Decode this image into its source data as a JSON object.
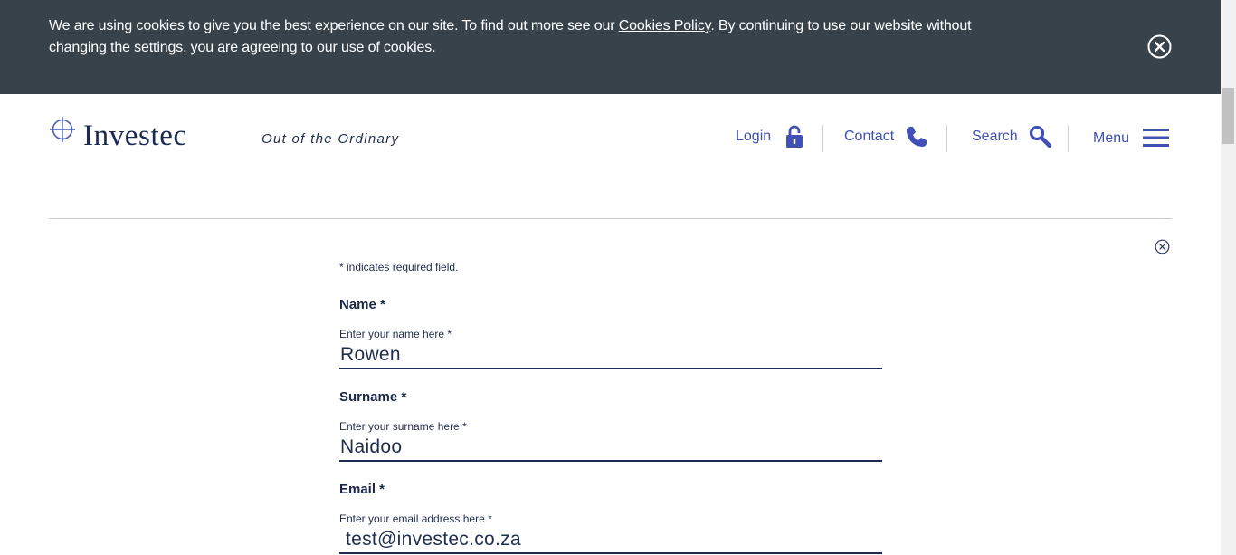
{
  "cookie_banner": {
    "text_before": "We are using cookies to give you the best experience on our site. To find out more see our ",
    "link": "Cookies Policy",
    "text_after": ". By continuing to use our website without changing the settings, you are agreeing to our use of cookies.",
    "close_icon": "close-circle-icon"
  },
  "header": {
    "brand": "Investec",
    "tagline": "Out of the Ordinary",
    "nav": {
      "login": "Login",
      "contact": "Contact",
      "search": "Search",
      "menu": "Menu"
    },
    "icons": {
      "login": "lock-icon",
      "contact": "phone-icon",
      "search": "search-icon",
      "menu": "hamburger-icon"
    },
    "accent_color": "#4050b5"
  },
  "form": {
    "required_note": "* indicates required field.",
    "fields": {
      "name": {
        "heading": "Name *",
        "label": "Enter your name here *",
        "value": "Rowen"
      },
      "surname": {
        "heading": "Surname *",
        "label": "Enter your surname here *",
        "value": "Naidoo"
      },
      "email": {
        "heading": "Email *",
        "label": "Enter your email address here *",
        "value": "test@investec.co.za"
      }
    }
  }
}
